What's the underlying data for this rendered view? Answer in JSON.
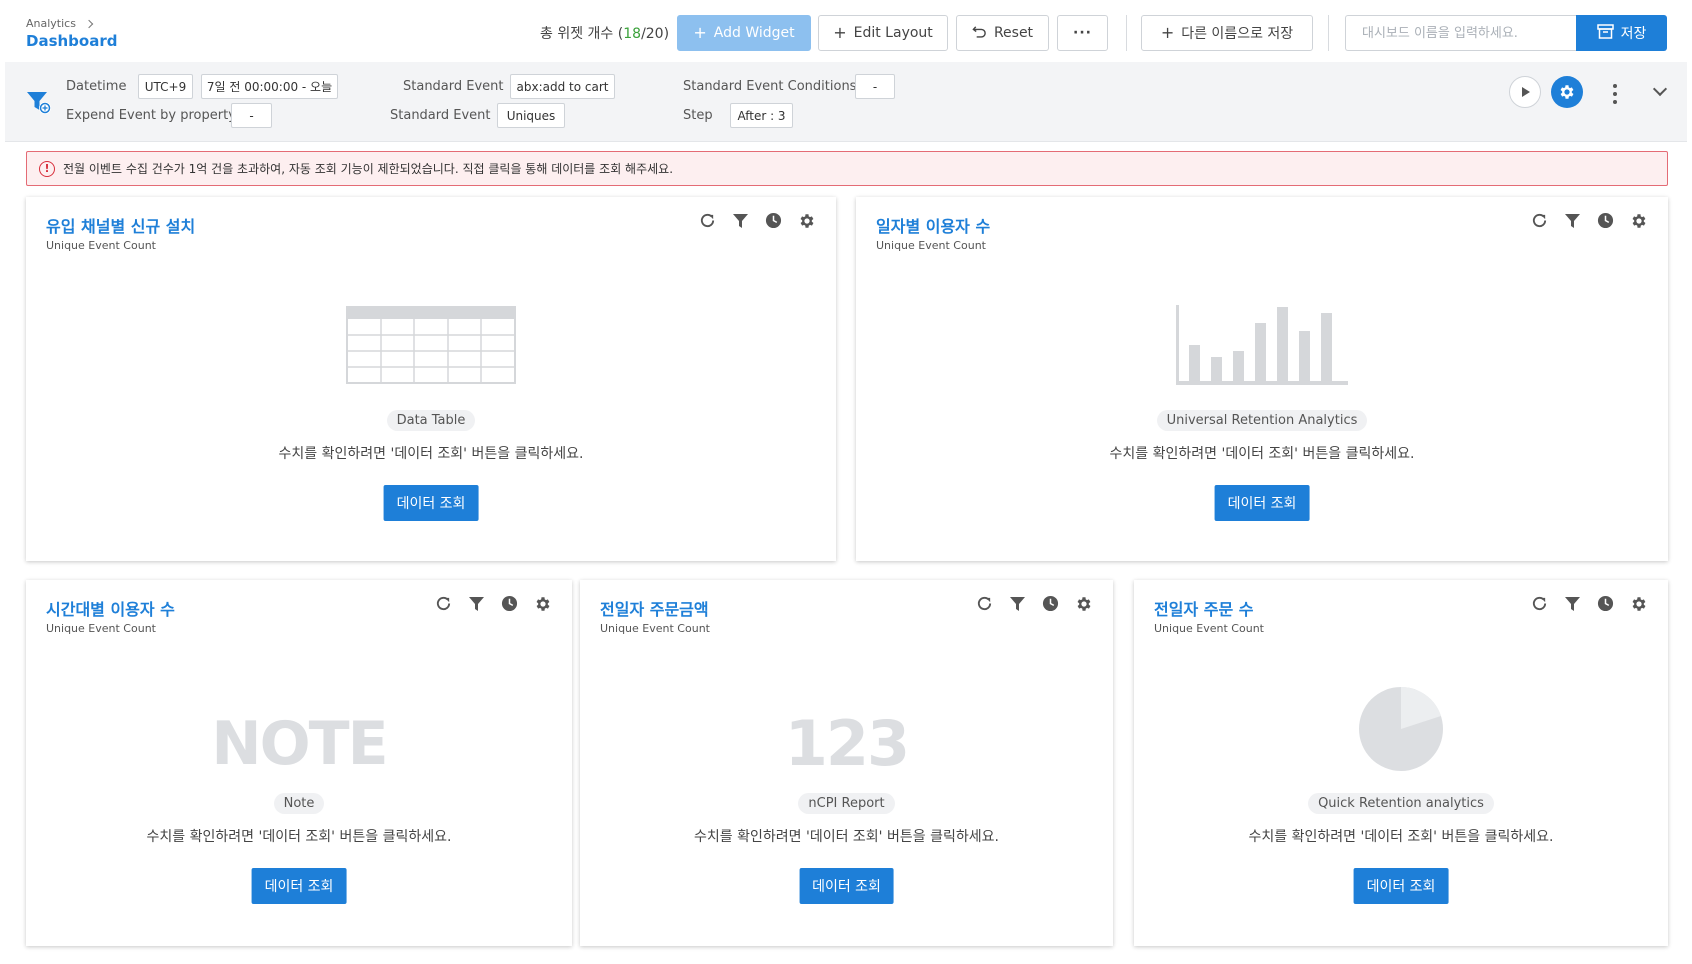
{
  "header": {
    "breadcrumb": "Analytics",
    "title": "Dashboard",
    "widget_count_label": "총 위젯 개수",
    "widget_count_used": "18",
    "widget_count_total": "/20)",
    "add_widget": "Add Widget",
    "edit_layout": "Edit Layout",
    "reset": "Reset",
    "more": "···",
    "save_as": "다른 이름으로 저장",
    "dashboard_name_placeholder": "대시보드 이름을 입력하세요.",
    "save": "저장"
  },
  "filters": {
    "datetime_label": "Datetime",
    "timezone": "UTC+9",
    "date_range": "7일 전 00:00:00 - 오늘",
    "expend_label": "Expend Event by property",
    "expend_value": "-",
    "standard_event_label": "Standard Event",
    "standard_event_value": "abx:add to cart",
    "standard_event2_label": "Standard Event",
    "standard_event2_value": "Uniques",
    "conditions_label": "Standard Event Conditions",
    "conditions_value": "-",
    "step_label": "Step",
    "step_value": "After : 3"
  },
  "alert": {
    "message": "전월 이벤트 수집 건수가 1억 건을 초과하여, 자동 조회 기능이 제한되었습니다. 직접 클릭을 통해 데이터를 조회 해주세요."
  },
  "widget_common": {
    "message": "수치를 확인하려면 '데이터 조회' 버튼을 클릭하세요.",
    "button": "데이터 조회"
  },
  "widgets": [
    {
      "title": "유입 채널별 신규 설치",
      "subtitle": "Unique Event Count",
      "type": "Data Table"
    },
    {
      "title": "일자별 이용자 수",
      "subtitle": "Unique Event Count",
      "type": "Universal Retention Analytics"
    },
    {
      "title": "시간대별 이용자 수",
      "subtitle": "Unique Event Count",
      "type": "Note",
      "placeholder": "NOTE"
    },
    {
      "title": "전일자 주문금액",
      "subtitle": "Unique Event Count",
      "type": "nCPI Report",
      "placeholder": "123"
    },
    {
      "title": "전일자 주문 수",
      "subtitle": "Unique Event Count",
      "type": "Quick Retention analytics"
    }
  ],
  "colors": {
    "accent": "#1e7fd8",
    "accent_light": "#8dc0ef",
    "count_green": "#3aa13a",
    "alert_border": "#e46b75",
    "alert_bg": "#fdeff0"
  }
}
